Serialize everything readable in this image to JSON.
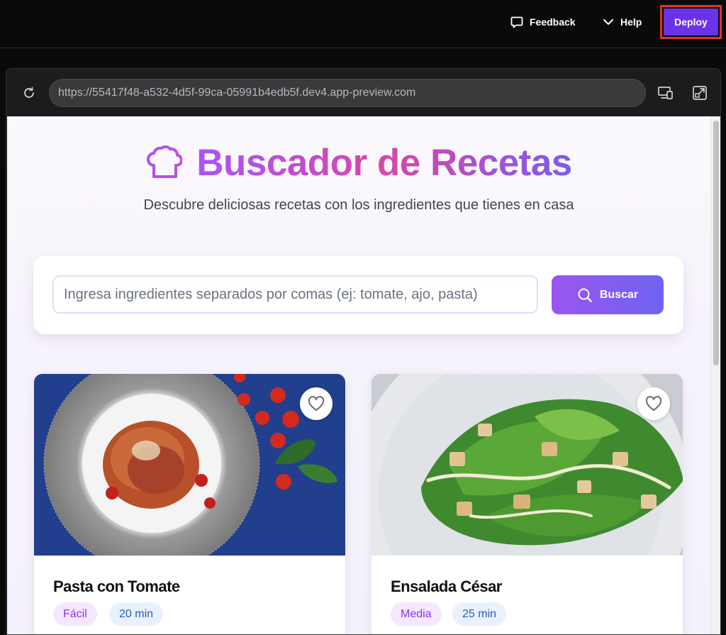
{
  "topbar": {
    "feedback_label": "Feedback",
    "help_label": "Help",
    "deploy_label": "Deploy"
  },
  "browser": {
    "url": "https://55417f48-a532-4d5f-99ca-05991b4edb5f.dev4.app-preview.com"
  },
  "app": {
    "title": "Buscador de Recetas",
    "subtitle": "Descubre deliciosas recetas con los ingredientes que tienes en casa",
    "search_placeholder": "Ingresa ingredientes separados por comas (ej: tomate, ajo, pasta)",
    "search_button": "Buscar"
  },
  "recipes": [
    {
      "title": "Pasta con Tomate",
      "difficulty": "Fácil",
      "time": "20 min",
      "image": "spaghetti-plate-photo"
    },
    {
      "title": "Ensalada César",
      "difficulty": "Media",
      "time": "25 min",
      "image": "caesar-salad-photo"
    }
  ],
  "colors": {
    "accent_purple": "#6a33e8",
    "deploy_outline": "#e2341d",
    "title_gradient_start": "#a855f7",
    "title_gradient_mid": "#d946a8",
    "title_gradient_end": "#7c5cf0"
  }
}
